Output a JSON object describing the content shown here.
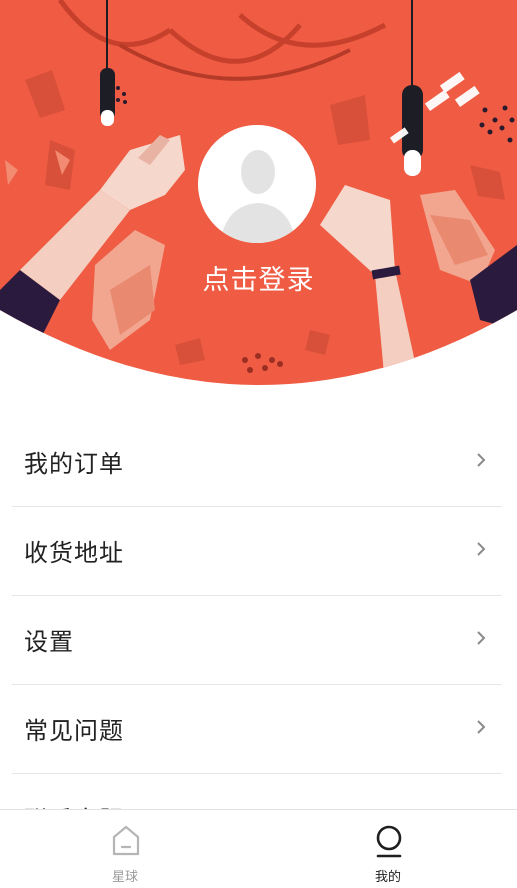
{
  "theme": {
    "accent": "#ef5c43",
    "accent_dark": "#c7402c"
  },
  "header": {
    "avatar_icon": "user-silhouette-icon",
    "login_text": "点击登录"
  },
  "menu": {
    "items": [
      {
        "label": "我的订单",
        "icon": "chevron-right-icon"
      },
      {
        "label": "收货地址",
        "icon": "chevron-right-icon"
      },
      {
        "label": "设置",
        "icon": "chevron-right-icon"
      },
      {
        "label": "常见问题",
        "icon": "chevron-right-icon"
      },
      {
        "label": "联系客服",
        "icon": "chevron-right-icon"
      }
    ]
  },
  "tabbar": {
    "tabs": [
      {
        "label": "星球",
        "icon": "house-icon",
        "active": false
      },
      {
        "label": "我的",
        "icon": "profile-icon",
        "active": true
      }
    ]
  }
}
